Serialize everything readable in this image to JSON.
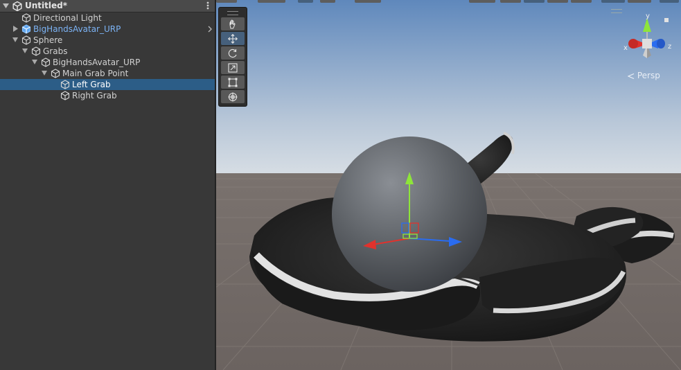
{
  "hierarchy": {
    "scene_title": "Untitled*",
    "items": [
      {
        "label": "Directional Light",
        "depth": 0,
        "expanded": false,
        "has_children": false,
        "prefab": false,
        "selected": false
      },
      {
        "label": "BigHandsAvatar_URP",
        "depth": 0,
        "expanded": false,
        "has_children": true,
        "prefab": true,
        "selected": false
      },
      {
        "label": "Sphere",
        "depth": 0,
        "expanded": true,
        "has_children": true,
        "prefab": false,
        "selected": false
      },
      {
        "label": "Grabs",
        "depth": 1,
        "expanded": true,
        "has_children": true,
        "prefab": false,
        "selected": false
      },
      {
        "label": "BigHandsAvatar_URP",
        "depth": 2,
        "expanded": true,
        "has_children": true,
        "prefab": false,
        "selected": false
      },
      {
        "label": "Main Grab Point",
        "depth": 3,
        "expanded": true,
        "has_children": true,
        "prefab": false,
        "selected": false
      },
      {
        "label": "Left Grab",
        "depth": 4,
        "expanded": false,
        "has_children": false,
        "prefab": false,
        "selected": true
      },
      {
        "label": "Right Grab",
        "depth": 4,
        "expanded": false,
        "has_children": false,
        "prefab": false,
        "selected": false
      }
    ]
  },
  "scene_view": {
    "tools": [
      {
        "name": "hand-tool",
        "icon": "hand-icon",
        "active": false
      },
      {
        "name": "move-tool",
        "icon": "move-arrows-icon",
        "active": true
      },
      {
        "name": "rotate-tool",
        "icon": "rotate-icon",
        "active": false
      },
      {
        "name": "scale-tool",
        "icon": "scale-icon",
        "active": false
      },
      {
        "name": "rect-tool",
        "icon": "rect-transform-icon",
        "active": false
      },
      {
        "name": "transform-tool",
        "icon": "transform-icon",
        "active": false
      }
    ],
    "gizmo": {
      "y_label": "y",
      "x_label": "x",
      "z_label": "z"
    },
    "projection_label": "Persp",
    "colors": {
      "selection": "#2c5d87",
      "prefab_text": "#7cb3f5",
      "axis_x": "#e0322d",
      "axis_y": "#8ee53a",
      "axis_z": "#2a6cf0"
    }
  }
}
